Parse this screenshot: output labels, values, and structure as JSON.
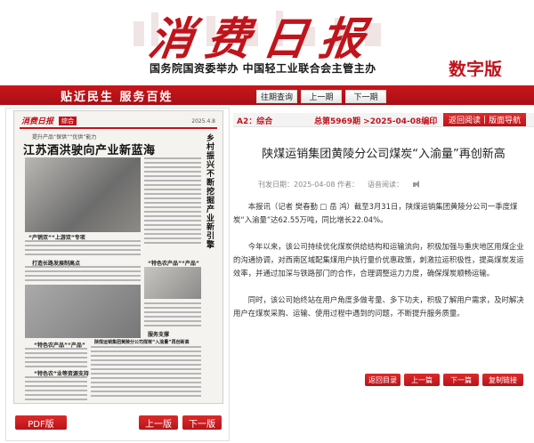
{
  "masthead": {
    "logo": "消费日报",
    "sponsor": "国务院国资委举办  中国轻工业联合会主管主办",
    "digital_badge": "数字版"
  },
  "nav": {
    "slogan": "贴近民生  服务百姓",
    "tabs": [
      "往期查询",
      "上一期",
      "下一期"
    ]
  },
  "page_preview": {
    "masthead": "消费日报",
    "section": "综合",
    "date": "2025.4.8",
    "kicker": "提升产品“保供”“优供”能力",
    "lead_headline": "江苏酒洪驶向产业新蓝海",
    "vertical_headline": "乡村振兴不断挖掘产业新引擎",
    "sub_headlines": [
      "“产销双”“上游双”专项",
      "打造长路发展制高点",
      "陕煤运销集团黄陵分公司煤炭“入渝量”再创新高",
      "“特色农产品”“产品”",
      "服务支撑",
      "“特色农产品”“产品”",
      "“特色农”业等资源支持"
    ],
    "pdf_label": "PDF版",
    "prev_label": "上一版",
    "next_label": "下一版"
  },
  "article": {
    "section": "A2：综合",
    "count": "总第5969期 >2025-04-08编印",
    "buttons": [
      "返回阅读",
      "|",
      "版面导航"
    ],
    "title": "陕煤运销集团黄陵分公司煤炭“入渝量”再创新高",
    "date_label": "刊发日期：2025-04-08 作者：",
    "read_label": "语音阅读：",
    "paragraphs": [
      "本报讯（记者 樊春勤 □ 岳 鸿）截至3月31日，陕煤运销集团黄陵分公司一季度煤炭“入渝量”达62.55万吨，同比增长22.04%。",
      "今年以来，该公司持续优化煤炭供给结构和运输流向，积极加强与重庆地区用煤企业的沟通协调，对西南区域配集煤用户执行量价优惠政策，刺激拉运积极性，提高煤炭发运效率，并通过加深与铁路部门的合作，合理调整运力力度，确保煤炭顺畅运输。",
      "同时，该公司始终站在用户角度多做考量、多下功夫，积极了解用户需求，及时解决用户在煤炭采购、运输、使用过程中遇到的问题，不断提升服务质量。"
    ],
    "bottom_buttons": [
      "返回目录",
      "上一篇",
      "下一篇",
      "复制链接"
    ]
  },
  "colors": {
    "brand_red": "#c0141c"
  }
}
